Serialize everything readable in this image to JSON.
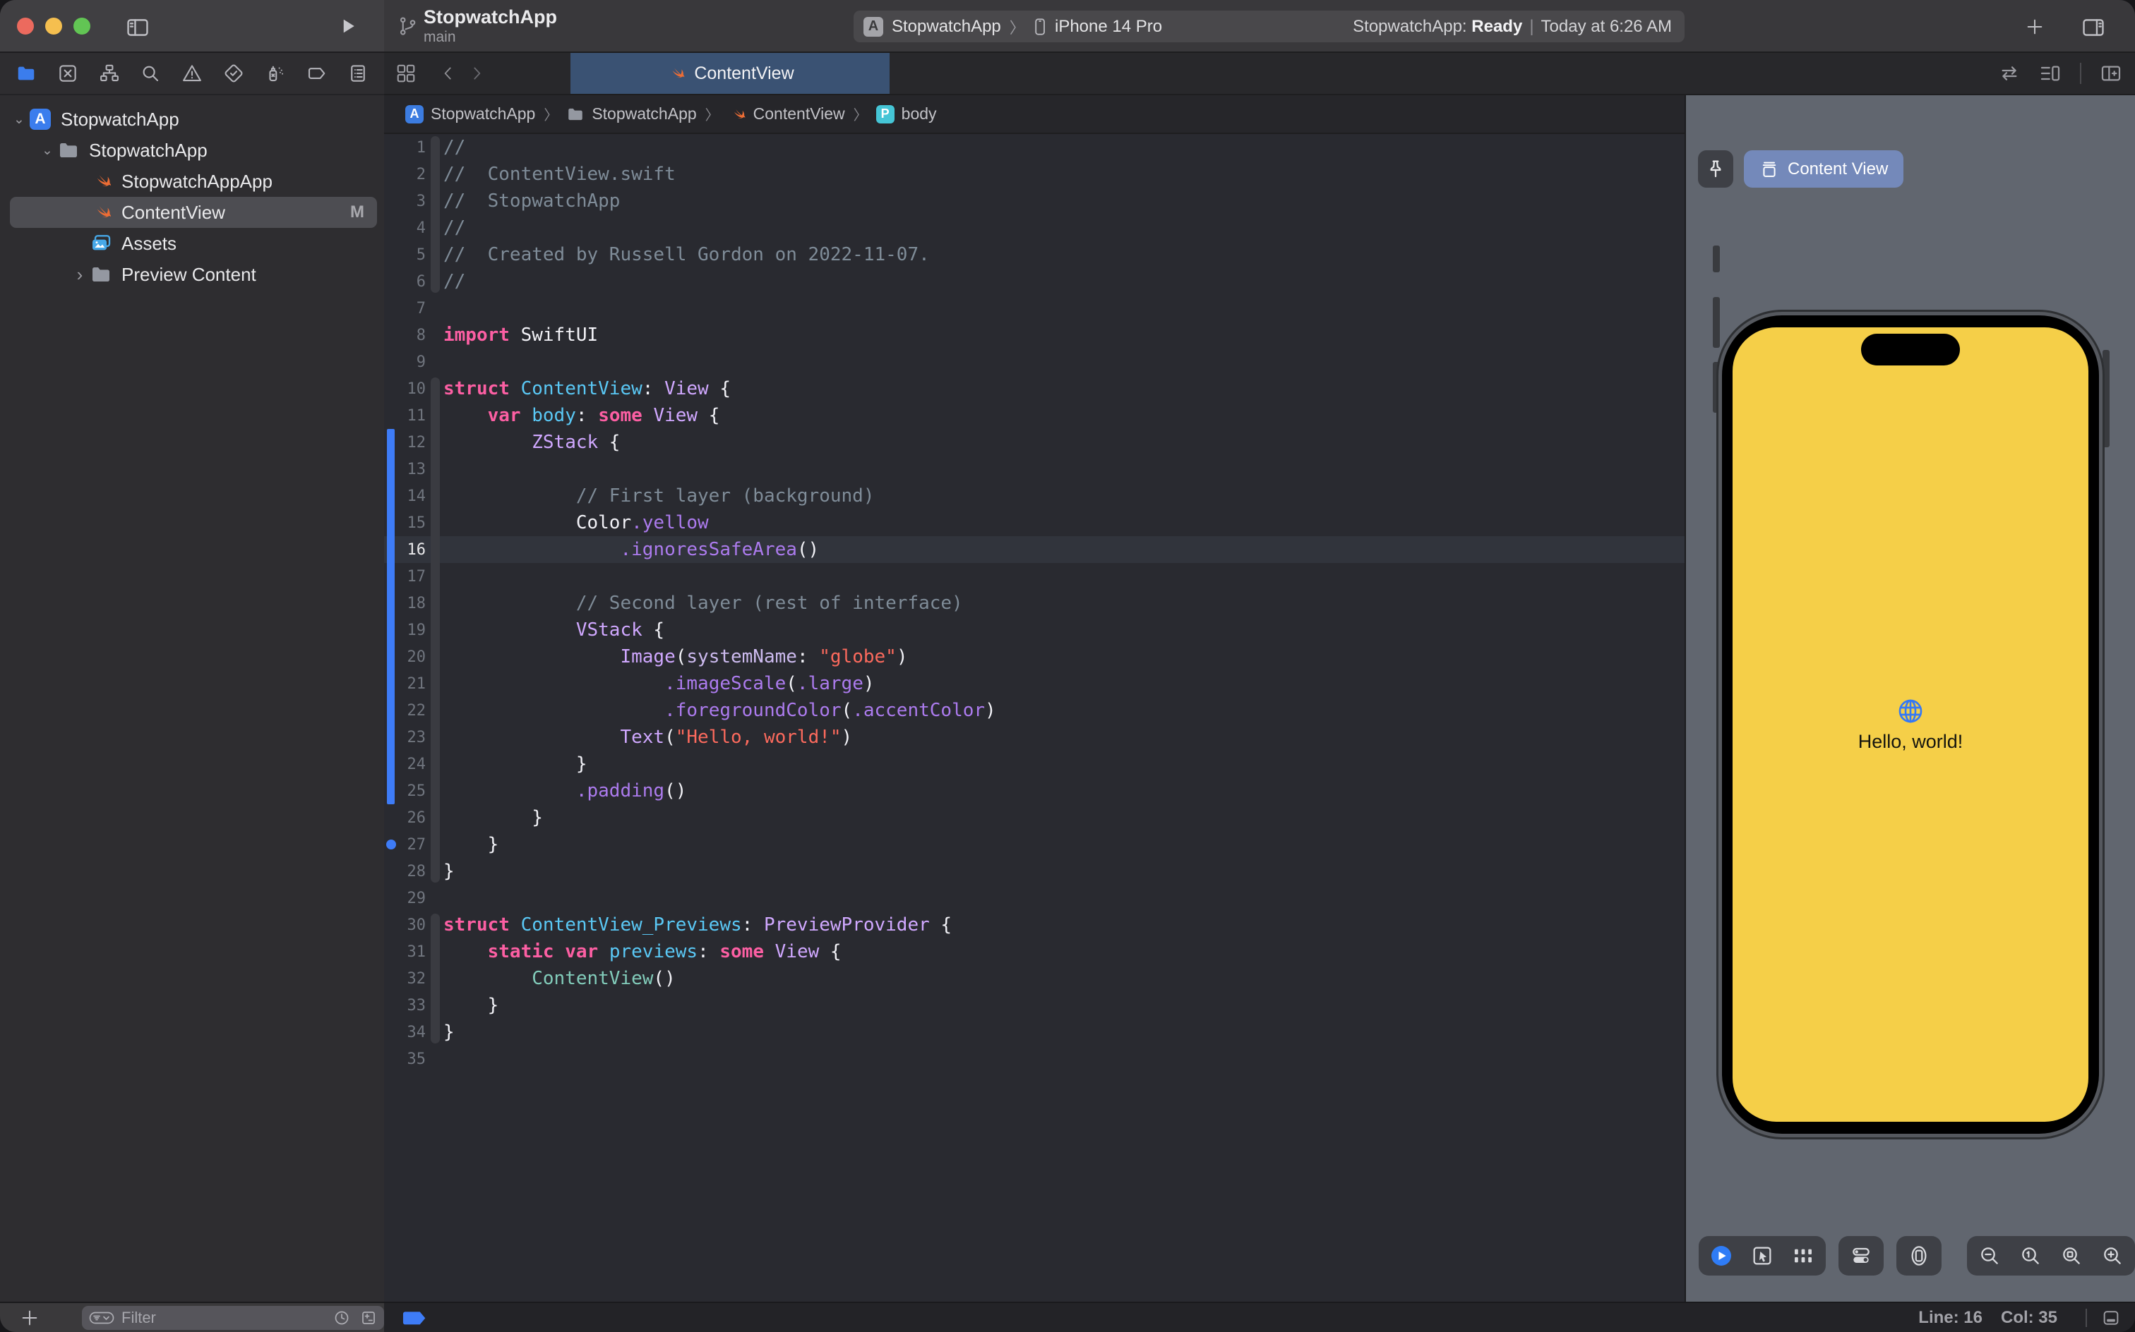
{
  "window": {
    "title": "StopwatchApp",
    "subtitle": "main"
  },
  "toolbar": {
    "scheme": {
      "project": "StopwatchApp",
      "separator": "〉",
      "destination": "iPhone 14 Pro"
    },
    "status": {
      "prefix": "StopwatchApp:",
      "state": "Ready",
      "separator": "|",
      "time": "Today at 6:26 AM"
    }
  },
  "navigator": {
    "tabs": [
      {
        "name": "project-navigator-icon",
        "active": true
      },
      {
        "name": "source-control-icon",
        "active": false
      },
      {
        "name": "symbols-icon",
        "active": false
      },
      {
        "name": "search-icon",
        "active": false
      },
      {
        "name": "issues-icon",
        "active": false
      },
      {
        "name": "tests-icon",
        "active": false
      },
      {
        "name": "debug-icon",
        "active": false
      },
      {
        "name": "breakpoints-icon",
        "active": false
      },
      {
        "name": "reports-icon",
        "active": false
      }
    ],
    "tree": [
      {
        "label": "StopwatchApp",
        "icon": "app-project-icon",
        "level": 0,
        "disclosure": "down",
        "selected": false,
        "badge": ""
      },
      {
        "label": "StopwatchApp",
        "icon": "folder-icon",
        "level": 1,
        "disclosure": "down",
        "selected": false,
        "badge": ""
      },
      {
        "label": "StopwatchAppApp",
        "icon": "swift-file-icon",
        "level": 2,
        "disclosure": "none",
        "selected": false,
        "badge": ""
      },
      {
        "label": "ContentView",
        "icon": "swift-file-icon",
        "level": 2,
        "disclosure": "none",
        "selected": true,
        "badge": "M"
      },
      {
        "label": "Assets",
        "icon": "assets-icon",
        "level": 2,
        "disclosure": "none",
        "selected": false,
        "badge": ""
      },
      {
        "label": "Preview Content",
        "icon": "folder-icon",
        "level": 2,
        "disclosure": "right",
        "selected": false,
        "badge": ""
      }
    ],
    "filter": {
      "placeholder": "Filter"
    }
  },
  "tabs": {
    "active_label": "ContentView"
  },
  "breadcrumb": [
    {
      "icon": "app-project-badge",
      "label": "StopwatchApp"
    },
    {
      "icon": "folder-icon",
      "label": "StopwatchApp"
    },
    {
      "icon": "swift-file-icon",
      "label": "ContentView"
    },
    {
      "icon": "property-badge",
      "label": "body"
    }
  ],
  "syntax_colors": {
    "plain": "#f2f2f7",
    "keyword": "#fc5fa3",
    "comment": "#7f8c98",
    "string": "#fc6a5d",
    "decl": "#5ac8f5",
    "type": "#d0a8ff",
    "member": "#ac7bee",
    "param": "#cdbbef",
    "projtype": "#82ccba"
  },
  "editor": {
    "current_line": 16,
    "change_bar": {
      "from_line": 12,
      "to_line": 25
    },
    "change_dot_line": 27,
    "ribbon_segments": [
      {
        "from": 1,
        "to": 6
      },
      {
        "from": 10,
        "to": 28
      },
      {
        "from": 30,
        "to": 34
      }
    ],
    "lines": [
      {
        "n": 1,
        "seg": [
          [
            "//",
            "comment"
          ]
        ]
      },
      {
        "n": 2,
        "seg": [
          [
            "//  ContentView.swift",
            "comment"
          ]
        ]
      },
      {
        "n": 3,
        "seg": [
          [
            "//  StopwatchApp",
            "comment"
          ]
        ]
      },
      {
        "n": 4,
        "seg": [
          [
            "//",
            "comment"
          ]
        ]
      },
      {
        "n": 5,
        "seg": [
          [
            "//  Created by Russell Gordon on 2022-11-07.",
            "comment"
          ]
        ]
      },
      {
        "n": 6,
        "seg": [
          [
            "//",
            "comment"
          ]
        ]
      },
      {
        "n": 7,
        "seg": []
      },
      {
        "n": 8,
        "seg": [
          [
            "import",
            "keyword"
          ],
          [
            " SwiftUI",
            "plain"
          ]
        ]
      },
      {
        "n": 9,
        "seg": []
      },
      {
        "n": 10,
        "seg": [
          [
            "struct",
            "keyword"
          ],
          [
            " ",
            "plain"
          ],
          [
            "ContentView",
            "decl"
          ],
          [
            ": ",
            "plain"
          ],
          [
            "View",
            "type"
          ],
          [
            " {",
            "plain"
          ]
        ]
      },
      {
        "n": 11,
        "seg": [
          [
            "    ",
            "plain"
          ],
          [
            "var",
            "keyword"
          ],
          [
            " ",
            "plain"
          ],
          [
            "body",
            "decl"
          ],
          [
            ": ",
            "plain"
          ],
          [
            "some",
            "keyword"
          ],
          [
            " ",
            "plain"
          ],
          [
            "View",
            "type"
          ],
          [
            " {",
            "plain"
          ]
        ]
      },
      {
        "n": 12,
        "seg": [
          [
            "        ",
            "plain"
          ],
          [
            "ZStack",
            "type"
          ],
          [
            " {",
            "plain"
          ]
        ]
      },
      {
        "n": 13,
        "seg": []
      },
      {
        "n": 14,
        "seg": [
          [
            "            ",
            "plain"
          ],
          [
            "// First layer (background)",
            "comment"
          ]
        ]
      },
      {
        "n": 15,
        "seg": [
          [
            "            Color",
            "plain"
          ],
          [
            ".yellow",
            "member"
          ]
        ]
      },
      {
        "n": 16,
        "seg": [
          [
            "                ",
            "plain"
          ],
          [
            ".ignoresSafeArea",
            "member"
          ],
          [
            "()",
            "plain"
          ]
        ]
      },
      {
        "n": 17,
        "seg": []
      },
      {
        "n": 18,
        "seg": [
          [
            "            ",
            "plain"
          ],
          [
            "// Second layer (rest of interface)",
            "comment"
          ]
        ]
      },
      {
        "n": 19,
        "seg": [
          [
            "            ",
            "plain"
          ],
          [
            "VStack",
            "type"
          ],
          [
            " {",
            "plain"
          ]
        ]
      },
      {
        "n": 20,
        "seg": [
          [
            "                ",
            "plain"
          ],
          [
            "Image",
            "type"
          ],
          [
            "(",
            "plain"
          ],
          [
            "systemName",
            "param"
          ],
          [
            ": ",
            "plain"
          ],
          [
            "\"globe\"",
            "string"
          ],
          [
            ")",
            "plain"
          ]
        ]
      },
      {
        "n": 21,
        "seg": [
          [
            "                    ",
            "plain"
          ],
          [
            ".imageScale",
            "member"
          ],
          [
            "(",
            "plain"
          ],
          [
            ".large",
            "member"
          ],
          [
            ")",
            "plain"
          ]
        ]
      },
      {
        "n": 22,
        "seg": [
          [
            "                    ",
            "plain"
          ],
          [
            ".foregroundColor",
            "member"
          ],
          [
            "(",
            "plain"
          ],
          [
            ".accentColor",
            "member"
          ],
          [
            ")",
            "plain"
          ]
        ]
      },
      {
        "n": 23,
        "seg": [
          [
            "                ",
            "plain"
          ],
          [
            "Text",
            "type"
          ],
          [
            "(",
            "plain"
          ],
          [
            "\"Hello, world!\"",
            "string"
          ],
          [
            ")",
            "plain"
          ]
        ]
      },
      {
        "n": 24,
        "seg": [
          [
            "            }",
            "plain"
          ]
        ]
      },
      {
        "n": 25,
        "seg": [
          [
            "            ",
            "plain"
          ],
          [
            ".padding",
            "member"
          ],
          [
            "()",
            "plain"
          ]
        ]
      },
      {
        "n": 26,
        "seg": [
          [
            "        }",
            "plain"
          ]
        ]
      },
      {
        "n": 27,
        "seg": [
          [
            "    }",
            "plain"
          ]
        ]
      },
      {
        "n": 28,
        "seg": [
          [
            "}",
            "plain"
          ]
        ]
      },
      {
        "n": 29,
        "seg": []
      },
      {
        "n": 30,
        "seg": [
          [
            "struct",
            "keyword"
          ],
          [
            " ",
            "plain"
          ],
          [
            "ContentView_Previews",
            "decl"
          ],
          [
            ": ",
            "plain"
          ],
          [
            "PreviewProvider",
            "type"
          ],
          [
            " {",
            "plain"
          ]
        ]
      },
      {
        "n": 31,
        "seg": [
          [
            "    ",
            "plain"
          ],
          [
            "static",
            "keyword"
          ],
          [
            " ",
            "plain"
          ],
          [
            "var",
            "keyword"
          ],
          [
            " ",
            "plain"
          ],
          [
            "previews",
            "decl"
          ],
          [
            ": ",
            "plain"
          ],
          [
            "some",
            "keyword"
          ],
          [
            " ",
            "plain"
          ],
          [
            "View",
            "type"
          ],
          [
            " {",
            "plain"
          ]
        ]
      },
      {
        "n": 32,
        "seg": [
          [
            "        ",
            "plain"
          ],
          [
            "ContentView",
            "projtype"
          ],
          [
            "()",
            "plain"
          ]
        ]
      },
      {
        "n": 33,
        "seg": [
          [
            "    }",
            "plain"
          ]
        ]
      },
      {
        "n": 34,
        "seg": [
          [
            "}",
            "plain"
          ]
        ]
      },
      {
        "n": 35,
        "seg": []
      }
    ]
  },
  "preview": {
    "tab_label": "Content View",
    "device": {
      "name": "iphone-14-pro",
      "screen_color": "#f5cf48",
      "accent_color": "#3478f6",
      "text": "Hello, world!"
    },
    "controls": {
      "groups": [
        {
          "icons": [
            "live-preview-play-icon",
            "selectable-pointer-icon",
            "variants-grid-icon"
          ]
        },
        {
          "icons": [
            "device-settings-icon"
          ]
        },
        {
          "icons": [
            "preview-on-device-icon"
          ]
        }
      ],
      "zoom_group": [
        "zoom-out-icon",
        "zoom-actual-size-icon",
        "zoom-to-fit-icon",
        "zoom-in-icon"
      ]
    }
  },
  "statusbar": {
    "line": "Line: 16",
    "col": "Col: 35"
  },
  "colors": {
    "accent_blue": "#3b7ded",
    "swift_orange": "#ed6d35",
    "tab_active": "#3a5273",
    "canvas_gray": "#61666f",
    "editor_bg": "#292a30"
  }
}
